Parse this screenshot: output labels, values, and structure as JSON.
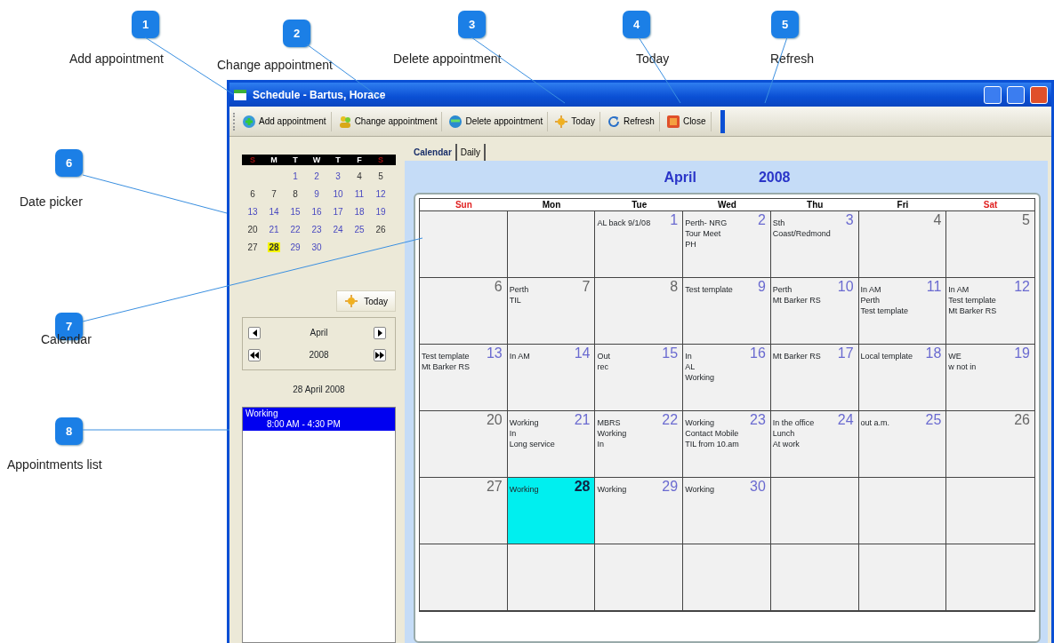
{
  "callouts": [
    {
      "number": "1",
      "label": "Add appointment"
    },
    {
      "number": "2",
      "label": "Change appointment"
    },
    {
      "number": "3",
      "label": "Delete appointment"
    },
    {
      "number": "4",
      "label": "Today"
    },
    {
      "number": "5",
      "label": "Refresh"
    },
    {
      "number": "6",
      "label": "Date picker"
    },
    {
      "number": "7",
      "label": "Calendar"
    },
    {
      "number": "8",
      "label": "Appointments list"
    }
  ],
  "window": {
    "title": "Schedule - Bartus, Horace"
  },
  "toolbar": [
    {
      "label": "Add appointment",
      "kind": "add"
    },
    {
      "label": "Change appointment",
      "kind": "change"
    },
    {
      "label": "Delete appointment",
      "kind": "delete"
    },
    {
      "label": "Today",
      "kind": "today"
    },
    {
      "label": "Refresh",
      "kind": "refresh"
    },
    {
      "label": "Close",
      "kind": "close"
    }
  ],
  "date_picker": {
    "weekdays": [
      {
        "label": "S",
        "weekend": true
      },
      {
        "label": "M",
        "weekend": false
      },
      {
        "label": "T",
        "weekend": false
      },
      {
        "label": "W",
        "weekend": false
      },
      {
        "label": "T",
        "weekend": false
      },
      {
        "label": "F",
        "weekend": false
      },
      {
        "label": "S",
        "weekend": true
      }
    ],
    "weeks": [
      [
        {
          "day": "1",
          "busy": true,
          "selected": false
        },
        {
          "day": "2",
          "busy": true,
          "selected": false
        },
        {
          "day": "3",
          "busy": true,
          "selected": false
        },
        {
          "day": "4",
          "busy": false,
          "selected": false
        },
        {
          "day": "5",
          "busy": false,
          "selected": false
        }
      ],
      [
        {
          "day": "6",
          "busy": false,
          "selected": false
        },
        {
          "day": "7",
          "busy": false,
          "selected": false
        },
        {
          "day": "8",
          "busy": false,
          "selected": false
        },
        {
          "day": "9",
          "busy": true,
          "selected": false
        },
        {
          "day": "10",
          "busy": true,
          "selected": false
        },
        {
          "day": "11",
          "busy": true,
          "selected": false
        },
        {
          "day": "12",
          "busy": true,
          "selected": false
        }
      ],
      [
        {
          "day": "13",
          "busy": true,
          "selected": false
        },
        {
          "day": "14",
          "busy": true,
          "selected": false
        },
        {
          "day": "15",
          "busy": true,
          "selected": false
        },
        {
          "day": "16",
          "busy": true,
          "selected": false
        },
        {
          "day": "17",
          "busy": true,
          "selected": false
        },
        {
          "day": "18",
          "busy": true,
          "selected": false
        },
        {
          "day": "19",
          "busy": true,
          "selected": false
        }
      ],
      [
        {
          "day": "20",
          "busy": false,
          "selected": false
        },
        {
          "day": "21",
          "busy": true,
          "selected": false
        },
        {
          "day": "22",
          "busy": true,
          "selected": false
        },
        {
          "day": "23",
          "busy": true,
          "selected": false
        },
        {
          "day": "24",
          "busy": true,
          "selected": false
        },
        {
          "day": "25",
          "busy": true,
          "selected": false
        },
        {
          "day": "26",
          "busy": false,
          "selected": false
        }
      ],
      [
        {
          "day": "27",
          "busy": false,
          "selected": false
        },
        {
          "day": "28",
          "busy": false,
          "selected": true
        },
        {
          "day": "29",
          "busy": true,
          "selected": false
        },
        {
          "day": "30",
          "busy": true,
          "selected": false
        }
      ]
    ],
    "today_button": "Today",
    "month": "April",
    "year": "2008",
    "date": "28 April 2008"
  },
  "appointments": [
    {
      "title": "Working",
      "time": "8:00 AM - 4:30 PM",
      "selected": true
    }
  ],
  "tabs": [
    {
      "label": "Calendar",
      "selected": true
    },
    {
      "label": "Daily",
      "selected": false
    }
  ],
  "calendar": {
    "month": "April",
    "year": "2008",
    "columns": [
      {
        "label": "Sun",
        "weekend": true
      },
      {
        "label": "Mon",
        "weekend": false
      },
      {
        "label": "Tue",
        "weekend": false
      },
      {
        "label": "Wed",
        "weekend": false
      },
      {
        "label": "Thu",
        "weekend": false
      },
      {
        "label": "Fri",
        "weekend": false
      },
      {
        "label": "Sat",
        "weekend": true
      }
    ],
    "weeks": [
      [
        {
          "day": "1",
          "busy": true,
          "selected": false,
          "entries": [
            "AL back 9/1/08"
          ]
        },
        {
          "day": "2",
          "busy": true,
          "selected": false,
          "entries": [
            "Perth- NRG",
            "Tour Meet",
            "PH"
          ]
        },
        {
          "day": "3",
          "busy": true,
          "selected": false,
          "entries": [
            "Sth",
            "Coast/Redmond"
          ]
        },
        {
          "day": "4",
          "busy": false,
          "selected": false
        },
        {
          "day": "5",
          "busy": false,
          "selected": false
        }
      ],
      [
        {
          "day": "6",
          "busy": false,
          "selected": false
        },
        {
          "day": "7",
          "busy": false,
          "selected": false,
          "entries": [
            "Perth",
            "TIL"
          ]
        },
        {
          "day": "8",
          "busy": false,
          "selected": false
        },
        {
          "day": "9",
          "busy": true,
          "selected": false,
          "entries": [
            "Test template"
          ]
        },
        {
          "day": "10",
          "busy": true,
          "selected": false,
          "entries": [
            "Perth",
            "Mt Barker RS"
          ]
        },
        {
          "day": "11",
          "busy": true,
          "selected": false,
          "entries": [
            "In AM",
            "Perth",
            "Test template"
          ]
        },
        {
          "day": "12",
          "busy": true,
          "selected": false,
          "entries": [
            "In AM",
            "Test template",
            "Mt Barker RS"
          ]
        }
      ],
      [
        {
          "day": "13",
          "busy": true,
          "selected": false,
          "entries": [
            "Test template",
            "Mt Barker RS"
          ]
        },
        {
          "day": "14",
          "busy": true,
          "selected": false,
          "entries": [
            "In AM"
          ]
        },
        {
          "day": "15",
          "busy": true,
          "selected": false,
          "entries": [
            "Out",
            "rec"
          ]
        },
        {
          "day": "16",
          "busy": true,
          "selected": false,
          "entries": [
            "In",
            "AL",
            "Working"
          ]
        },
        {
          "day": "17",
          "busy": true,
          "selected": false,
          "entries": [
            "Mt Barker RS"
          ]
        },
        {
          "day": "18",
          "busy": true,
          "selected": false,
          "entries": [
            "Local template"
          ]
        },
        {
          "day": "19",
          "busy": true,
          "selected": false,
          "entries": [
            "WE",
            "w not in"
          ]
        }
      ],
      [
        {
          "day": "20",
          "busy": false,
          "selected": false
        },
        {
          "day": "21",
          "busy": true,
          "selected": false,
          "entries": [
            "Working",
            "In",
            "Long service"
          ]
        },
        {
          "day": "22",
          "busy": true,
          "selected": false,
          "entries": [
            "MBRS",
            "Working",
            "In"
          ]
        },
        {
          "day": "23",
          "busy": true,
          "selected": false,
          "entries": [
            "Working",
            "Contact Mobile",
            "TIL from 10.am"
          ]
        },
        {
          "day": "24",
          "busy": true,
          "selected": false,
          "entries": [
            "In the office",
            "Lunch",
            "At work"
          ]
        },
        {
          "day": "25",
          "busy": true,
          "selected": false,
          "entries": [
            "out a.m."
          ]
        },
        {
          "day": "26",
          "busy": false,
          "selected": false
        }
      ],
      [
        {
          "day": "27",
          "busy": false,
          "selected": false
        },
        {
          "day": "28",
          "busy": false,
          "selected": true,
          "entries": [
            "Working"
          ]
        },
        {
          "day": "29",
          "busy": true,
          "selected": false,
          "entries": [
            "Working"
          ]
        },
        {
          "day": "30",
          "busy": true,
          "selected": false,
          "entries": [
            "Working"
          ]
        }
      ]
    ]
  }
}
